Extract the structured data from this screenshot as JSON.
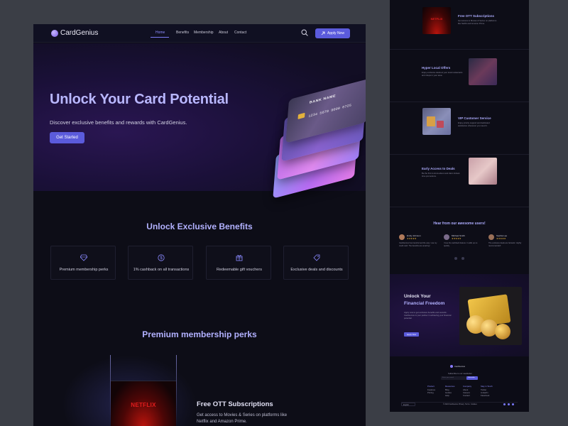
{
  "brand": {
    "name": "CardGenius",
    "accent": "#5b5bdc"
  },
  "nav": {
    "links": [
      "Home",
      "Benefits",
      "Membership",
      "About",
      "Contact"
    ],
    "apply_label": "Apply Now"
  },
  "hero": {
    "title": "Unlock Your Card Potential",
    "subtitle": "Discover exclusive benefits and rewards with CardGenius.",
    "cta": "Get Started",
    "card": {
      "bank": "BANK NAME",
      "number": "1234 5678 9000 0725"
    }
  },
  "benefits": {
    "title": "Unlock Exclusive Benefits",
    "items": [
      {
        "label": "Premium membership perks",
        "icon": "diamond-icon"
      },
      {
        "label": "1% cashback on all transactions",
        "icon": "dollar-icon"
      },
      {
        "label": "Redeemable gift vouchers",
        "icon": "gift-icon"
      },
      {
        "label": "Exclusive deals and discounts",
        "icon": "tag-icon"
      }
    ]
  },
  "perks": {
    "title": "Premium membership perks",
    "ott": {
      "title": "Free OTT Subscriptions",
      "desc": "Get access to Movies & Series on platforms like Netflix and Amazon Prime.",
      "logo": "NETFLIX"
    }
  },
  "right": {
    "rows": [
      {
        "title": "Free OTT Subscriptions",
        "desc": "Get access to Movies & Series on platforms like Netflix and Amazon Prime."
      },
      {
        "title": "Hyper Local Offers",
        "desc": "Enjoy exclusive deals at your local restaurants and shops in your area."
      },
      {
        "title": "VIP Customer Service",
        "desc": "Enjoy priority support and dedicated assistance whenever you need it."
      },
      {
        "title": "Early Access to Deals",
        "desc": "Be the first to know about and claim limited-time promotions."
      }
    ],
    "testimonials": {
      "title": "Hear from our awesome users!",
      "users": [
        {
          "name": "Emily Johnson",
          "stars": "★★★★★",
          "text": "CardGenius has transformed the way I use my credit card. The benefits are amazing!"
        },
        {
          "name": "Michael Smith",
          "stars": "★★★★★",
          "text": "I love the cashback feature. It adds up so quickly."
        },
        {
          "name": "Sophia Lee",
          "stars": "★★★★★",
          "text": "The exclusive deals are fantastic. Highly recommended!"
        }
      ]
    },
    "freedom": {
      "line1": "Unlock Your",
      "line2": "Financial Freedom",
      "desc": "Apply now to get exclusive benefits and rewards. CardGenius is your partner in achieving your financial potential.",
      "cta": "Apply Now"
    },
    "footer": {
      "brand": "CardGenius",
      "newsletter": "Subscribe to our newsletter",
      "email_placeholder": "Enter your email",
      "subscribe": "Subscribe",
      "cols": [
        {
          "head": "Product",
          "items": [
            "Features",
            "Pricing"
          ]
        },
        {
          "head": "Resources",
          "items": [
            "Blog",
            "Guides",
            "Help"
          ]
        },
        {
          "head": "Company",
          "items": [
            "About",
            "Careers",
            "Contact"
          ]
        },
        {
          "head": "Stay in Touch",
          "items": [
            "Twitter",
            "LinkedIn",
            "Facebook"
          ]
        }
      ],
      "lang": "English",
      "copyright": "© 2024 CardGenius",
      "legal": [
        "Privacy",
        "Terms",
        "Cookies"
      ]
    }
  }
}
